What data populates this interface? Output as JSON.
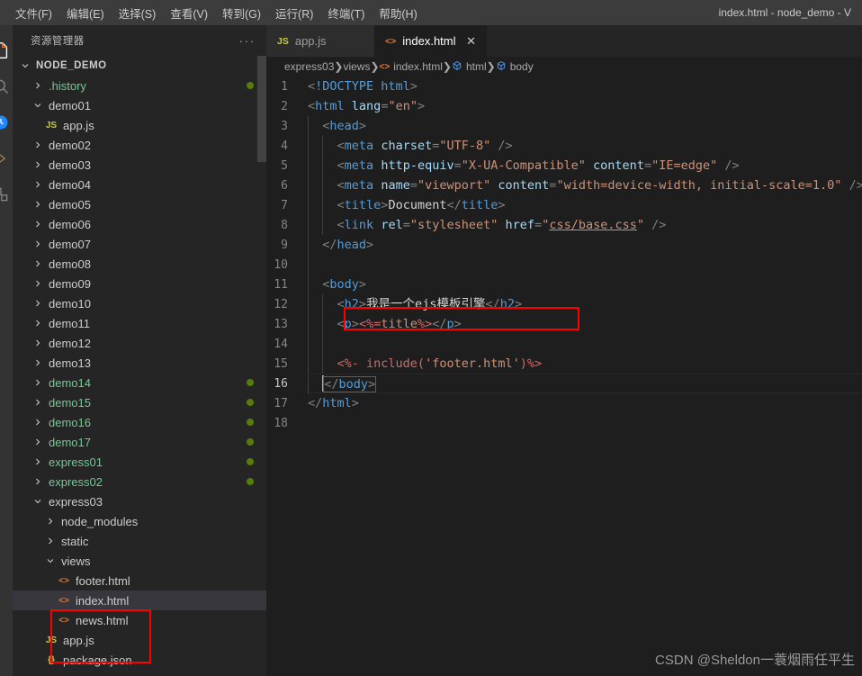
{
  "window": {
    "title": "index.html - node_demo - V",
    "colors": {
      "titlebar_bg": "#3c3c3c",
      "sidebar_bg": "#252526",
      "editor_bg": "#1e1e1e",
      "activitybar_bg": "#333333",
      "selection_bg": "#37373d",
      "git_untracked": "#73c991",
      "git_dot": "#587c0c",
      "highlight_box": "#ff0000",
      "html_icon": "#e37933",
      "js_icon": "#cbcb41"
    }
  },
  "menubar": {
    "items": [
      {
        "label": "文件(F)"
      },
      {
        "label": "编辑(E)"
      },
      {
        "label": "选择(S)"
      },
      {
        "label": "查看(V)"
      },
      {
        "label": "转到(G)"
      },
      {
        "label": "运行(R)"
      },
      {
        "label": "终端(T)"
      },
      {
        "label": "帮助(H)"
      }
    ]
  },
  "activitybar": {
    "items": [
      {
        "name": "explorer-icon"
      },
      {
        "name": "search-icon"
      },
      {
        "name": "source-control-icon"
      },
      {
        "name": "run-debug-icon"
      },
      {
        "name": "extensions-icon"
      }
    ]
  },
  "sidebar": {
    "title": "资源管理器",
    "more_label": "···",
    "root": {
      "label": "NODE_DEMO",
      "expanded": true
    },
    "items": [
      {
        "label": ".history",
        "indent": 1,
        "type": "folder",
        "state": "collapsed",
        "green": true,
        "dot": true
      },
      {
        "label": "demo01",
        "indent": 1,
        "type": "folder",
        "state": "expanded",
        "green": false,
        "dot": false
      },
      {
        "label": "app.js",
        "indent": 2,
        "type": "js",
        "state": "file",
        "green": false,
        "dot": false
      },
      {
        "label": "demo02",
        "indent": 1,
        "type": "folder",
        "state": "collapsed",
        "green": false,
        "dot": false
      },
      {
        "label": "demo03",
        "indent": 1,
        "type": "folder",
        "state": "collapsed",
        "green": false,
        "dot": false
      },
      {
        "label": "demo04",
        "indent": 1,
        "type": "folder",
        "state": "collapsed",
        "green": false,
        "dot": false
      },
      {
        "label": "demo05",
        "indent": 1,
        "type": "folder",
        "state": "collapsed",
        "green": false,
        "dot": false
      },
      {
        "label": "demo06",
        "indent": 1,
        "type": "folder",
        "state": "collapsed",
        "green": false,
        "dot": false
      },
      {
        "label": "demo07",
        "indent": 1,
        "type": "folder",
        "state": "collapsed",
        "green": false,
        "dot": false
      },
      {
        "label": "demo08",
        "indent": 1,
        "type": "folder",
        "state": "collapsed",
        "green": false,
        "dot": false
      },
      {
        "label": "demo09",
        "indent": 1,
        "type": "folder",
        "state": "collapsed",
        "green": false,
        "dot": false
      },
      {
        "label": "demo10",
        "indent": 1,
        "type": "folder",
        "state": "collapsed",
        "green": false,
        "dot": false
      },
      {
        "label": "demo11",
        "indent": 1,
        "type": "folder",
        "state": "collapsed",
        "green": false,
        "dot": false
      },
      {
        "label": "demo12",
        "indent": 1,
        "type": "folder",
        "state": "collapsed",
        "green": false,
        "dot": false
      },
      {
        "label": "demo13",
        "indent": 1,
        "type": "folder",
        "state": "collapsed",
        "green": false,
        "dot": false
      },
      {
        "label": "demo14",
        "indent": 1,
        "type": "folder",
        "state": "collapsed",
        "green": true,
        "dot": true
      },
      {
        "label": "demo15",
        "indent": 1,
        "type": "folder",
        "state": "collapsed",
        "green": true,
        "dot": true
      },
      {
        "label": "demo16",
        "indent": 1,
        "type": "folder",
        "state": "collapsed",
        "green": true,
        "dot": true
      },
      {
        "label": "demo17",
        "indent": 1,
        "type": "folder",
        "state": "collapsed",
        "green": true,
        "dot": true
      },
      {
        "label": "express01",
        "indent": 1,
        "type": "folder",
        "state": "collapsed",
        "green": true,
        "dot": true
      },
      {
        "label": "express02",
        "indent": 1,
        "type": "folder",
        "state": "collapsed",
        "green": true,
        "dot": true
      },
      {
        "label": "express03",
        "indent": 1,
        "type": "folder",
        "state": "expanded",
        "green": false,
        "dot": false
      },
      {
        "label": "node_modules",
        "indent": 2,
        "type": "folder",
        "state": "collapsed",
        "green": false,
        "dot": false
      },
      {
        "label": "static",
        "indent": 2,
        "type": "folder",
        "state": "collapsed",
        "green": false,
        "dot": false
      },
      {
        "label": "views",
        "indent": 2,
        "type": "folder",
        "state": "expanded",
        "green": false,
        "dot": false
      },
      {
        "label": "footer.html",
        "indent": 3,
        "type": "html",
        "state": "file",
        "green": false,
        "dot": false
      },
      {
        "label": "index.html",
        "indent": 3,
        "type": "html",
        "state": "file",
        "green": false,
        "dot": false,
        "selected": true
      },
      {
        "label": "news.html",
        "indent": 3,
        "type": "html",
        "state": "file",
        "green": false,
        "dot": false
      },
      {
        "label": "app.js",
        "indent": 2,
        "type": "js",
        "state": "file",
        "green": false,
        "dot": false
      },
      {
        "label": "package.json",
        "indent": 2,
        "type": "json",
        "state": "file",
        "green": false,
        "dot": false
      }
    ]
  },
  "tabs": [
    {
      "label": "app.js",
      "icon": "js-icon",
      "active": false,
      "close_label": "✕"
    },
    {
      "label": "index.html",
      "icon": "html-icon",
      "active": true,
      "close_label": "✕"
    }
  ],
  "breadcrumbs": [
    {
      "label": "express03",
      "icon": ""
    },
    {
      "label": "views",
      "icon": ""
    },
    {
      "label": "index.html",
      "icon": "html-icon"
    },
    {
      "label": "html",
      "icon": "symbol-icon"
    },
    {
      "label": "body",
      "icon": "symbol-icon"
    }
  ],
  "editor": {
    "language": "html",
    "current_line": 16,
    "line_numbers": [
      1,
      2,
      3,
      4,
      5,
      6,
      7,
      8,
      9,
      10,
      11,
      12,
      13,
      14,
      15,
      16,
      17,
      18
    ],
    "lines": [
      "<!DOCTYPE html>",
      "<html lang=\"en\">",
      "  <head>",
      "    <meta charset=\"UTF-8\" />",
      "    <meta http-equiv=\"X-UA-Compatible\" content=\"IE=edge\" />",
      "    <meta name=\"viewport\" content=\"width=device-width, initial-scale=1.0\" />",
      "    <title>Document</title>",
      "    <link rel=\"stylesheet\" href=\"css/base.css\" />",
      "  </head>",
      "",
      "  <body>",
      "    <h2>我是一个ejs模板引擎</h2>",
      "    <p><%=title%></p>",
      "",
      "    <%- include('footer.html')%>",
      "  </body>",
      "</html>",
      ""
    ]
  },
  "annotations": {
    "code_highlight_line": 15,
    "tree_highlight_files": [
      "footer.html",
      "index.html",
      "news.html"
    ]
  },
  "watermark": {
    "text": "CSDN @Sheldon一蓑烟雨任平生"
  }
}
